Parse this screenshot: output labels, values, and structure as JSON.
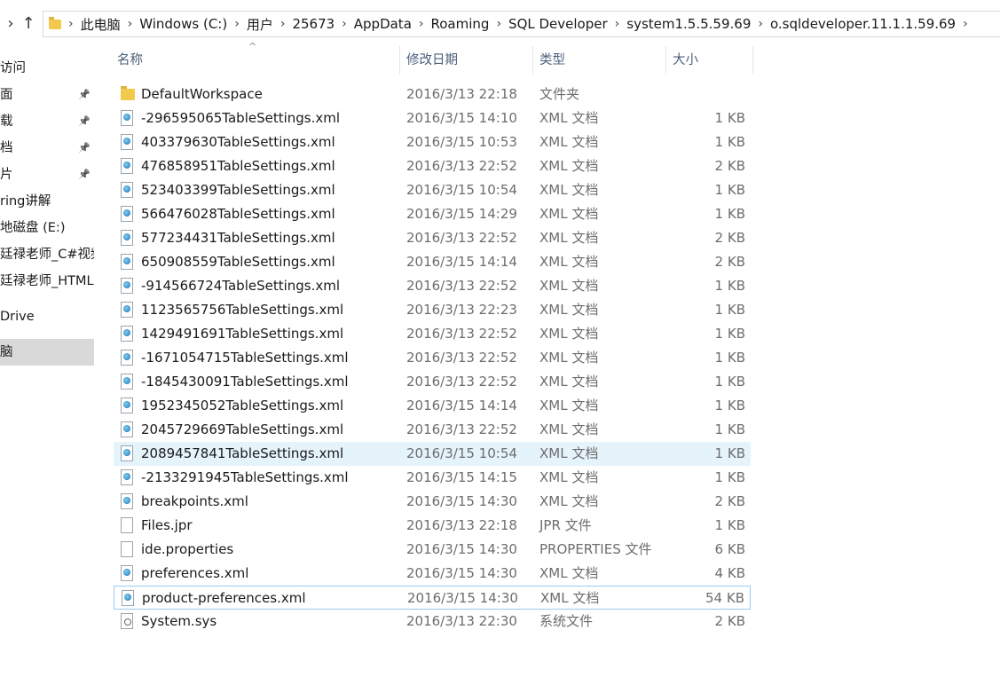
{
  "breadcrumb": [
    "此电脑",
    "Windows (C:)",
    "用户",
    "25673",
    "AppData",
    "Roaming",
    "SQL Developer",
    "system1.5.5.59.69",
    "o.sqldeveloper.11.1.1.59.69"
  ],
  "sidebar": [
    {
      "label": "访问",
      "pinned": false
    },
    {
      "label": "面",
      "pinned": true
    },
    {
      "label": "载",
      "pinned": true
    },
    {
      "label": "档",
      "pinned": true
    },
    {
      "label": "片",
      "pinned": true
    },
    {
      "label": "ring讲解",
      "pinned": false
    },
    {
      "label": "地磁盘 (E:)",
      "pinned": false
    },
    {
      "label": "廷禄老师_C#视频",
      "pinned": false
    },
    {
      "label": "廷禄老师_HTML",
      "pinned": false
    },
    {
      "label": "Drive",
      "pinned": false
    },
    {
      "label": "脑",
      "pinned": false,
      "selected": true
    }
  ],
  "columns": {
    "name": "名称",
    "date": "修改日期",
    "type": "类型",
    "size": "大小"
  },
  "files": [
    {
      "name": "DefaultWorkspace",
      "date": "2016/3/13 22:18",
      "type": "文件夹",
      "size": "",
      "icon": "folder-icon"
    },
    {
      "name": "-296595065TableSettings.xml",
      "date": "2016/3/15 14:10",
      "type": "XML 文档",
      "size": "1 KB",
      "icon": "xml-file-icon"
    },
    {
      "name": "403379630TableSettings.xml",
      "date": "2016/3/15 10:53",
      "type": "XML 文档",
      "size": "1 KB",
      "icon": "xml-file-icon"
    },
    {
      "name": "476858951TableSettings.xml",
      "date": "2016/3/13 22:52",
      "type": "XML 文档",
      "size": "2 KB",
      "icon": "xml-file-icon"
    },
    {
      "name": "523403399TableSettings.xml",
      "date": "2016/3/15 10:54",
      "type": "XML 文档",
      "size": "1 KB",
      "icon": "xml-file-icon"
    },
    {
      "name": "566476028TableSettings.xml",
      "date": "2016/3/15 14:29",
      "type": "XML 文档",
      "size": "1 KB",
      "icon": "xml-file-icon"
    },
    {
      "name": "577234431TableSettings.xml",
      "date": "2016/3/13 22:52",
      "type": "XML 文档",
      "size": "2 KB",
      "icon": "xml-file-icon"
    },
    {
      "name": "650908559TableSettings.xml",
      "date": "2016/3/15 14:14",
      "type": "XML 文档",
      "size": "2 KB",
      "icon": "xml-file-icon"
    },
    {
      "name": "-914566724TableSettings.xml",
      "date": "2016/3/13 22:52",
      "type": "XML 文档",
      "size": "1 KB",
      "icon": "xml-file-icon"
    },
    {
      "name": "1123565756TableSettings.xml",
      "date": "2016/3/13 22:23",
      "type": "XML 文档",
      "size": "1 KB",
      "icon": "xml-file-icon"
    },
    {
      "name": "1429491691TableSettings.xml",
      "date": "2016/3/13 22:52",
      "type": "XML 文档",
      "size": "1 KB",
      "icon": "xml-file-icon"
    },
    {
      "name": "-1671054715TableSettings.xml",
      "date": "2016/3/13 22:52",
      "type": "XML 文档",
      "size": "1 KB",
      "icon": "xml-file-icon"
    },
    {
      "name": "-1845430091TableSettings.xml",
      "date": "2016/3/13 22:52",
      "type": "XML 文档",
      "size": "1 KB",
      "icon": "xml-file-icon"
    },
    {
      "name": "1952345052TableSettings.xml",
      "date": "2016/3/15 14:14",
      "type": "XML 文档",
      "size": "1 KB",
      "icon": "xml-file-icon"
    },
    {
      "name": "2045729669TableSettings.xml",
      "date": "2016/3/13 22:52",
      "type": "XML 文档",
      "size": "1 KB",
      "icon": "xml-file-icon"
    },
    {
      "name": "2089457841TableSettings.xml",
      "date": "2016/3/15 10:54",
      "type": "XML 文档",
      "size": "1 KB",
      "icon": "xml-file-icon",
      "hover": true
    },
    {
      "name": "-2133291945TableSettings.xml",
      "date": "2016/3/15 14:15",
      "type": "XML 文档",
      "size": "1 KB",
      "icon": "xml-file-icon"
    },
    {
      "name": "breakpoints.xml",
      "date": "2016/3/15 14:30",
      "type": "XML 文档",
      "size": "2 KB",
      "icon": "xml-file-icon"
    },
    {
      "name": "Files.jpr",
      "date": "2016/3/13 22:18",
      "type": "JPR 文件",
      "size": "1 KB",
      "icon": "blank-file-icon"
    },
    {
      "name": "ide.properties",
      "date": "2016/3/15 14:30",
      "type": "PROPERTIES 文件",
      "size": "6 KB",
      "icon": "blank-file-icon"
    },
    {
      "name": "preferences.xml",
      "date": "2016/3/15 14:30",
      "type": "XML 文档",
      "size": "4 KB",
      "icon": "xml-file-icon"
    },
    {
      "name": "product-preferences.xml",
      "date": "2016/3/15 14:30",
      "type": "XML 文档",
      "size": "54 KB",
      "icon": "xml-file-icon",
      "focused": true
    },
    {
      "name": "System.sys",
      "date": "2016/3/13 22:30",
      "type": "系统文件",
      "size": "2 KB",
      "icon": "system-file-icon"
    }
  ]
}
